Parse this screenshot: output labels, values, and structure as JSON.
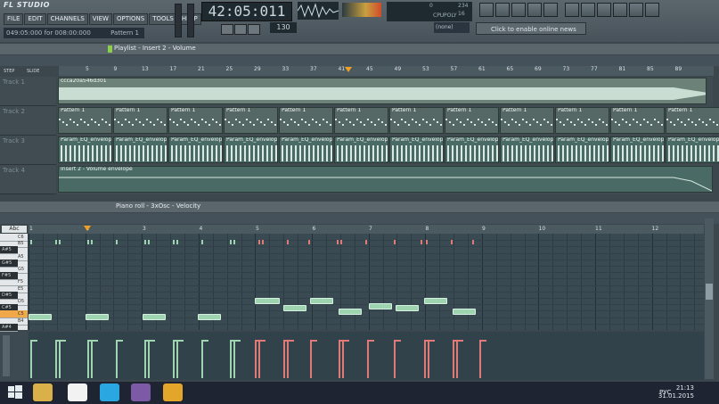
{
  "app": {
    "title": "FL STUDIO"
  },
  "menu": [
    "FILE",
    "EDIT",
    "CHANNELS",
    "VIEW",
    "OPTIONS",
    "TOOLS",
    "HELP"
  ],
  "hint": {
    "text": "049:05:000 for 008:00:000",
    "pattern": "Pattern 1"
  },
  "transport": {
    "time": "42:05:011",
    "tempo": "130",
    "preset": "(none)"
  },
  "cpu": {
    "left": "0",
    "mid": "234",
    "right": "16",
    "cpu_label": "CPU",
    "poly_label": "POLY"
  },
  "news": {
    "label": "Click to enable online news"
  },
  "playlist": {
    "title": "Playlist - Insert 2 - Volume",
    "step_label": "STEP",
    "slide_label": "SLIDE",
    "ruler": [
      "5",
      "9",
      "13",
      "17",
      "21",
      "25",
      "29",
      "33",
      "37",
      "41",
      "45",
      "49",
      "53",
      "57",
      "61",
      "65",
      "69",
      "73",
      "77",
      "81",
      "85",
      "89"
    ],
    "tracks": [
      {
        "label": "Track 1",
        "clip": "ccca20a546d301"
      },
      {
        "label": "Track 2",
        "clips": [
          "Pattern 1",
          "Pattern 1",
          "Pattern 1",
          "Pattern 1",
          "Pattern 1",
          "Pattern 1",
          "Pattern 1",
          "Pattern 1",
          "Pattern 1",
          "Pattern 1",
          "Pattern 1",
          "Pattern 1",
          "Pat..n 1"
        ]
      },
      {
        "label": "Track 3",
        "clips": [
          "Param_EQ_envelope",
          "Param_EQ_envelope",
          "Param_EQ_envelope",
          "Param_EQ_envelope",
          "Param_EQ_envelope",
          "Param_EQ_envelope",
          "Param_EQ_envelope",
          "Param_EQ_envelope",
          "Param_EQ_envelope",
          "Param_EQ_envelope",
          "Param_EQ_envelope",
          "Param_EQ_envelope",
          "Par..ope"
        ]
      },
      {
        "label": "Track 4",
        "clip": "Insert 2 - Volume envelope"
      }
    ]
  },
  "pianoroll": {
    "title": "Piano roll - 3xOsc",
    "mode": "Velocity",
    "key_label": "Abc",
    "ruler": [
      "1",
      "2",
      "3",
      "4",
      "5",
      "6",
      "7",
      "8",
      "9",
      "10",
      "11",
      "12"
    ],
    "keys": [
      "C6",
      "B5",
      "A#5",
      "A5",
      "G#5",
      "G5",
      "F#5",
      "F5",
      "E5",
      "D#5",
      "D5",
      "C#5",
      "C5",
      "B4",
      "A#4"
    ]
  },
  "taskbar": {
    "lang": "РУС",
    "time": "21:13",
    "date": "31.01.2015"
  }
}
